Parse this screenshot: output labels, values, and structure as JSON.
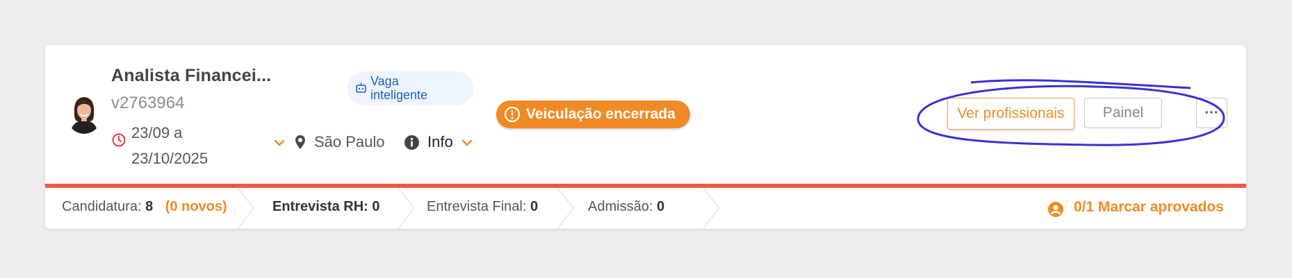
{
  "job": {
    "title": "Analista Financei...",
    "code": "v2763964",
    "dates_line1": "23/09 a",
    "dates_line2": "23/10/2025",
    "city": "São Paulo",
    "info_label": "Info",
    "smart_badge_line1": "Vaga",
    "smart_badge_line2": "inteligente",
    "status": "Veiculação encerrada"
  },
  "actions": {
    "view_professionals": "Ver profissionais",
    "panel": "Painel",
    "more": "···"
  },
  "pipeline": {
    "stages": [
      {
        "label": "Candidatura:",
        "count": "8",
        "extra": "(0 novos)"
      },
      {
        "label": "Entrevista RH:",
        "count": "0"
      },
      {
        "label": "Entrevista Final:",
        "count": "0"
      },
      {
        "label": "Admissão:",
        "count": "0"
      }
    ],
    "approve_label": "0/1 Marcar aprovados"
  },
  "colors": {
    "accent": "#f08a24",
    "danger_bar": "#ef5a42",
    "smart_badge_text": "#1f5fbf",
    "annotation": "#3a2fd6"
  },
  "icons": [
    "avatar",
    "clock-icon",
    "chevron-down-icon",
    "location-pin-icon",
    "info-icon",
    "robot-icon",
    "alert-circle-icon",
    "user-circle-icon"
  ]
}
